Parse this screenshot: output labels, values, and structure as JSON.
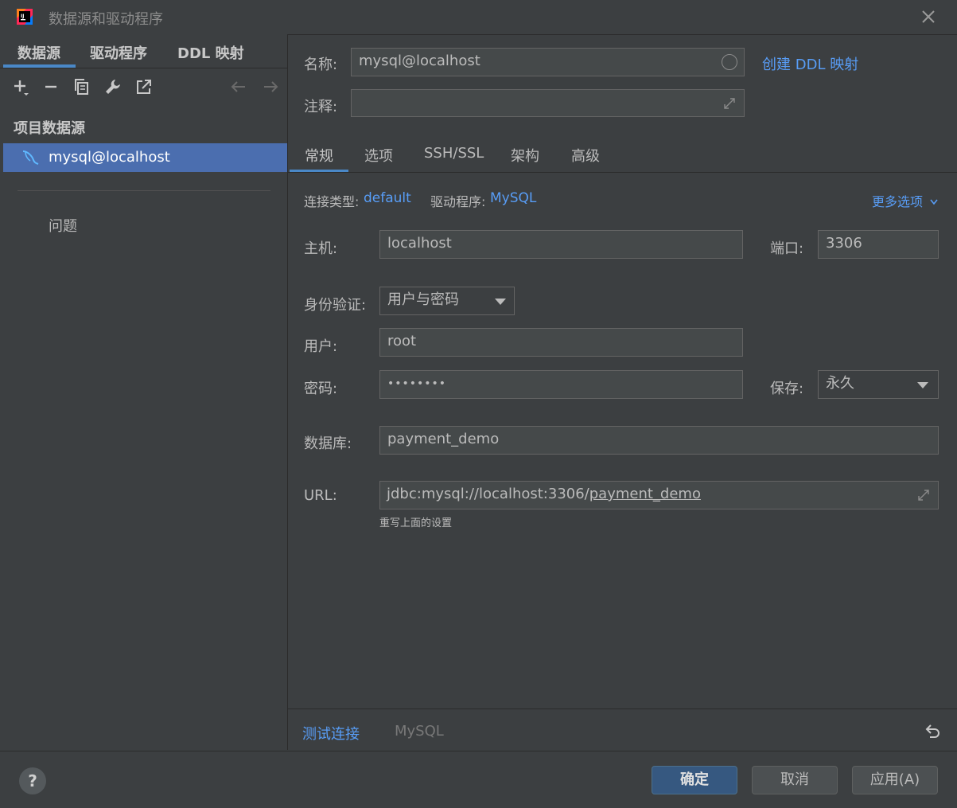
{
  "window": {
    "title": "数据源和驱动程序",
    "app_icon": "intellij-idea-icon",
    "close_icon": "close-icon"
  },
  "left_panel": {
    "tabs": [
      {
        "label": "数据源",
        "active": true
      },
      {
        "label": "驱动程序",
        "active": false
      },
      {
        "label": "DDL 映射",
        "active": false
      }
    ],
    "toolbar_icons": [
      "add-icon",
      "remove-icon",
      "duplicate-icon",
      "wrench-icon",
      "external-link-icon",
      "back-arrow-icon",
      "forward-arrow-icon"
    ],
    "section_title": "项目数据源",
    "datasources": [
      {
        "label": "mysql@localhost",
        "icon": "mysql-dolphin-icon",
        "selected": true
      }
    ],
    "problems_label": "问题"
  },
  "form": {
    "name_label": "名称:",
    "name_value": "mysql@localhost",
    "create_ddl_link": "创建 DDL 映射",
    "comment_label": "注释:",
    "comment_value": "",
    "tabs": [
      {
        "label": "常规",
        "active": true
      },
      {
        "label": "选项",
        "active": false
      },
      {
        "label": "SSH/SSL",
        "active": false
      },
      {
        "label": "架构",
        "active": false
      },
      {
        "label": "高级",
        "active": false
      }
    ],
    "connection_type_label": "连接类型:",
    "connection_type_value": "default",
    "driver_label": "驱动程序:",
    "driver_value": "MySQL",
    "more_options": "更多选项",
    "host_label": "主机:",
    "host_value": "localhost",
    "port_label": "端口:",
    "port_value": "3306",
    "auth_label": "身份验证:",
    "auth_value": "用户与密码",
    "user_label": "用户:",
    "user_value": "root",
    "password_label": "密码:",
    "password_value": "••••••••",
    "save_label": "保存:",
    "save_value": "永久",
    "database_label": "数据库:",
    "database_value": "payment_demo",
    "url_label": "URL:",
    "url_prefix": "jdbc:mysql://localhost:3306/",
    "url_db": "payment_demo",
    "url_hint": "重写上面的设置",
    "test_connection": "测试连接",
    "driver_name": "MySQL"
  },
  "footer": {
    "help": "?",
    "ok": "确定",
    "cancel": "取消",
    "apply": "应用(A)"
  },
  "colors": {
    "background": "#3c3f41",
    "accent": "#4a88c7",
    "selection": "#4b6eaf",
    "link": "#589df6",
    "field_bg": "#45494a"
  }
}
